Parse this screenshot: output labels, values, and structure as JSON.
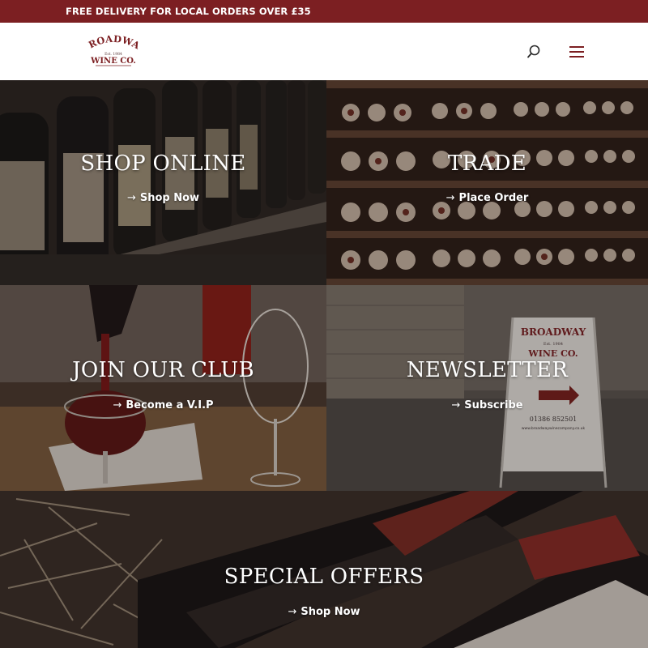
{
  "topbar": {
    "text": "FREE DELIVERY FOR LOCAL ORDERS OVER £35"
  },
  "header": {
    "logo": {
      "line1": "BROADWAY",
      "line2": "Est. 1984",
      "line3": "WINE CO."
    },
    "search_icon": "search-icon",
    "menu_icon": "hamburger-menu-icon"
  },
  "tiles": {
    "shop_online": {
      "title": "SHOP ONLINE",
      "link": "Shop Now",
      "arrow": "→"
    },
    "trade": {
      "title": "TRADE",
      "link": "Place Order",
      "arrow": "→"
    },
    "join_club": {
      "title": "JOIN OUR CLUB",
      "link": "Become a V.I.P",
      "arrow": "→"
    },
    "newsletter": {
      "title": "NEWSLETTER",
      "link": "Subscribe",
      "arrow": "→",
      "sign": {
        "line1": "BROADWAY",
        "line2": "Est. 1984",
        "line3": "WINE CO.",
        "phone": "01386 852501",
        "url": "www.broadwaywinecompany.co.uk"
      }
    },
    "special_offers": {
      "title": "SPECIAL OFFERS",
      "link": "Shop Now",
      "arrow": "→"
    }
  },
  "colors": {
    "brand": "#7c1f22",
    "header_bg": "#ffffff",
    "text_on_image": "#ffffff"
  }
}
